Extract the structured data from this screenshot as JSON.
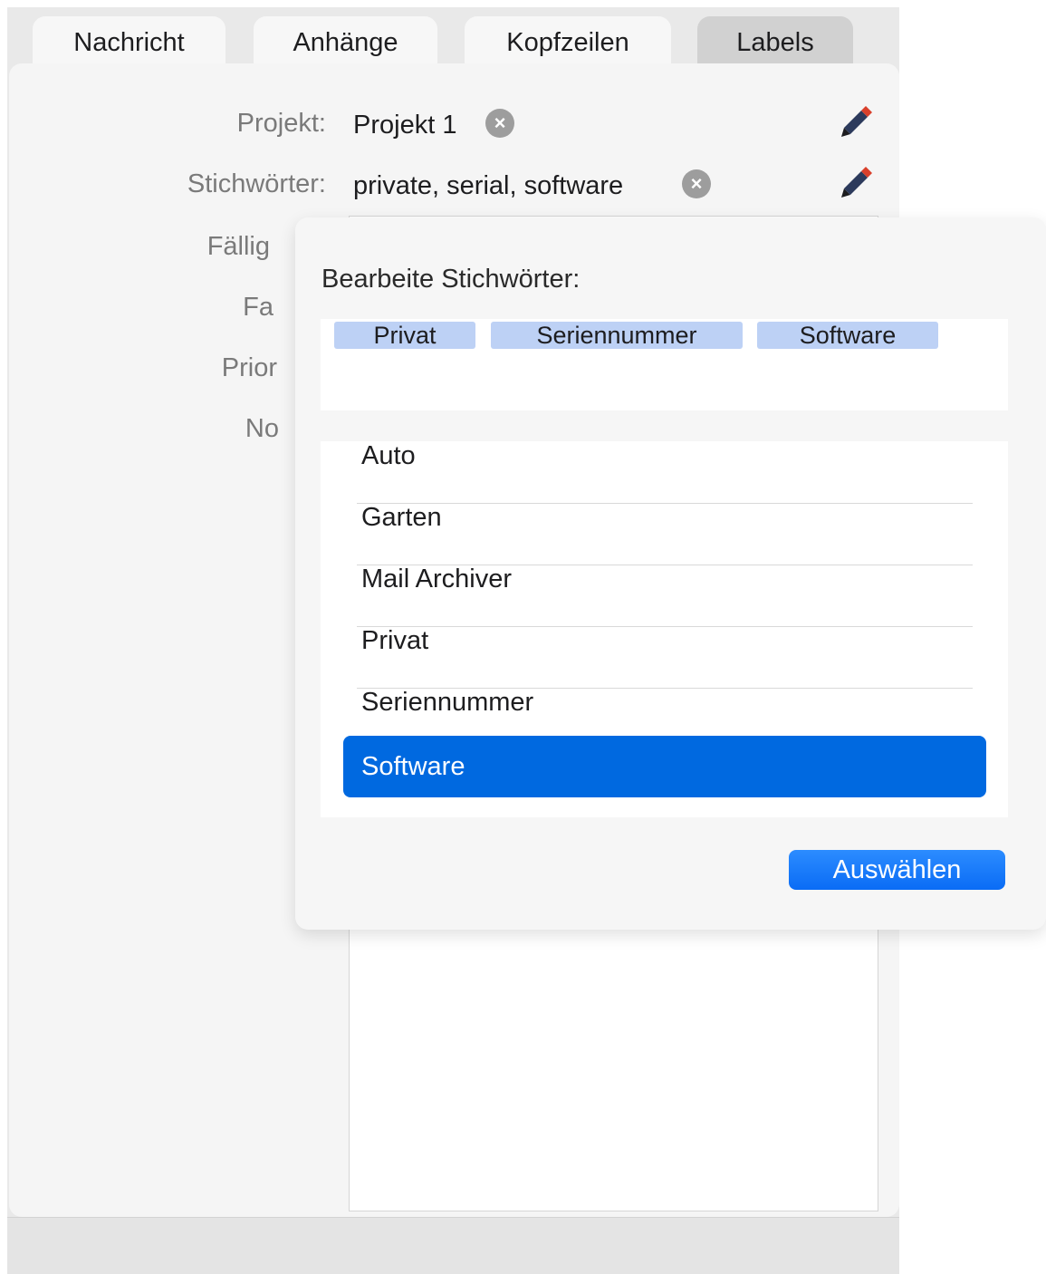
{
  "tabs": [
    {
      "label": "Nachricht",
      "selected": false
    },
    {
      "label": "Anhänge",
      "selected": false
    },
    {
      "label": "Kopfzeilen",
      "selected": false
    },
    {
      "label": "Labels",
      "selected": true
    }
  ],
  "fields": {
    "project_label": "Projekt:",
    "project_value": "Projekt 1",
    "keywords_label": "Stichwörter:",
    "keywords_value": "private, serial, software",
    "due_label": "Fällig",
    "color_label": "Fa",
    "priority_label": "Prior",
    "notes_label": "No"
  },
  "icons": {
    "clear": "clear-circle-icon",
    "edit": "pencil-icon"
  },
  "popover": {
    "title": "Bearbeite Stichwörter:",
    "tokens": [
      "Privat",
      "Seriennummer",
      "Software"
    ],
    "list": [
      "Auto",
      "Garten",
      "Mail Archiver",
      "Privat",
      "Seriennummer",
      "Software"
    ],
    "selected_item": "Software",
    "select_button": "Auswählen"
  },
  "colors": {
    "accent": "#0069e0",
    "token_bg": "#bdd1f5",
    "pencil_body": "#2c3a5c",
    "pencil_tip": "#d9402b"
  }
}
